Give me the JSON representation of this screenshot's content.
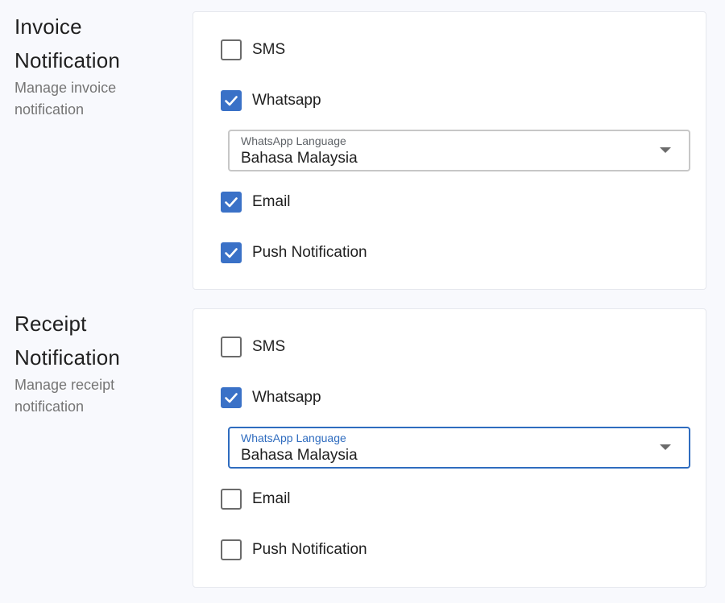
{
  "colors": {
    "accent": "#3a71c7",
    "focused_border": "#2f6cbf"
  },
  "sections": [
    {
      "title_line1": "Invoice",
      "title_line2": "Notification",
      "description": "Manage invoice notification",
      "options": {
        "sms": {
          "label": "SMS",
          "checked": false
        },
        "whatsapp": {
          "label": "Whatsapp",
          "checked": true
        },
        "email": {
          "label": "Email",
          "checked": true
        },
        "push": {
          "label": "Push Notification",
          "checked": true
        }
      },
      "whatsapp_language": {
        "label": "WhatsApp Language",
        "value": "Bahasa Malaysia",
        "focused": false,
        "icon": "dropdown-arrow-icon"
      }
    },
    {
      "title_line1": "Receipt",
      "title_line2": "Notification",
      "description": "Manage receipt notification",
      "options": {
        "sms": {
          "label": "SMS",
          "checked": false
        },
        "whatsapp": {
          "label": "Whatsapp",
          "checked": true
        },
        "email": {
          "label": "Email",
          "checked": false
        },
        "push": {
          "label": "Push Notification",
          "checked": false
        }
      },
      "whatsapp_language": {
        "label": "WhatsApp Language",
        "value": "Bahasa Malaysia",
        "focused": true,
        "icon": "dropdown-arrow-icon"
      }
    }
  ]
}
